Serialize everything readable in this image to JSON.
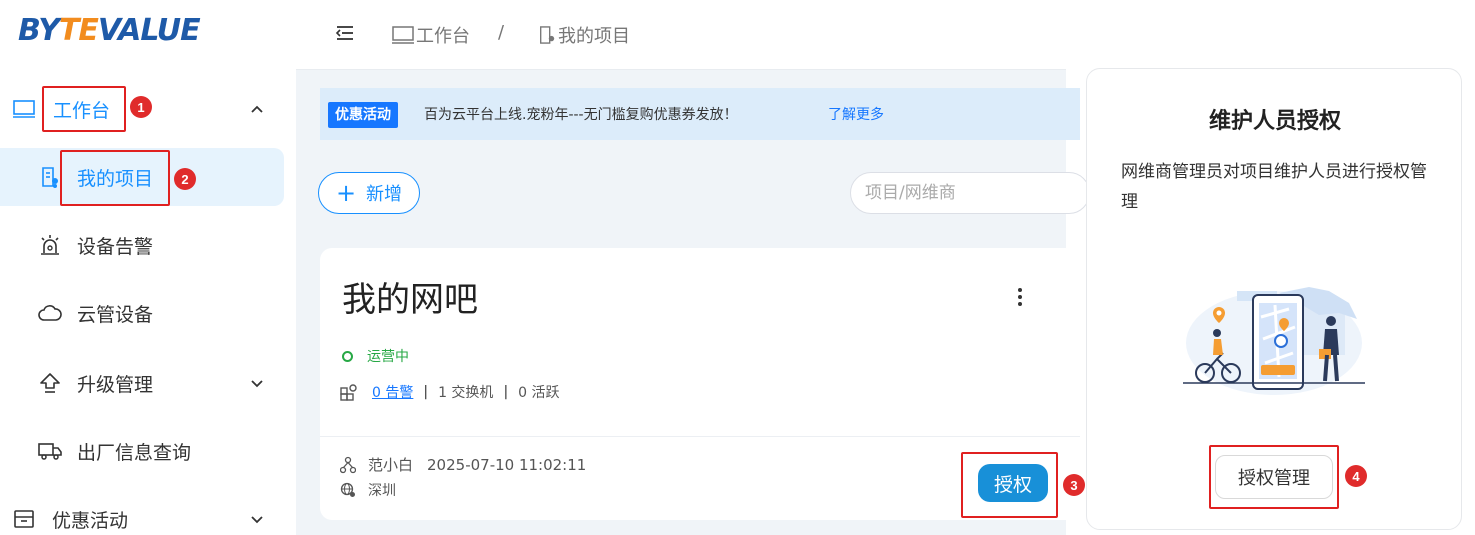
{
  "app": {
    "logo": {
      "part1": "BY",
      "part2": "TE",
      "part3": "VALUE"
    }
  },
  "sidebar": {
    "items": [
      {
        "label": "工作台",
        "icon": "monitor-icon",
        "expanded": true
      },
      {
        "label": "我的项目",
        "icon": "project-icon",
        "active": true
      },
      {
        "label": "设备告警",
        "icon": "alarm-light-icon"
      },
      {
        "label": "云管设备",
        "icon": "cloud-icon"
      },
      {
        "label": "升级管理",
        "icon": "upgrade-arrow-icon"
      },
      {
        "label": "出厂信息查询",
        "icon": "truck-icon"
      },
      {
        "label": "优惠活动",
        "icon": "store-icon"
      }
    ]
  },
  "breadcrumb": {
    "first": "工作台",
    "separator": "/",
    "second": "我的项目"
  },
  "promo": {
    "tag": "优惠活动",
    "text": "百为云平台上线.宠粉年---无门槛复购优惠券发放！",
    "link": "了解更多"
  },
  "toolbar": {
    "add_label": "新增",
    "search_placeholder": "项目/网维商"
  },
  "project_card": {
    "name": "我的网吧",
    "status": "运营中",
    "alarms": "0 告警",
    "switches": "1 交换机",
    "active": "0 活跃",
    "stat_separator": "|",
    "owner": "范小白",
    "created": "2025-07-10 11:02:11",
    "location": "深圳",
    "auth_label": "授权"
  },
  "popover": {
    "title": "维护人员授权",
    "description": "网维商管理员对项目维护人员进行授权管理",
    "button_label": "授权管理"
  },
  "annotations": {
    "steps": [
      "1",
      "2",
      "3",
      "4"
    ],
    "color": "#e02020"
  },
  "colors": {
    "primary": "#1890ff",
    "status_green": "#27a845",
    "promo_bg": "#dcecfa"
  }
}
